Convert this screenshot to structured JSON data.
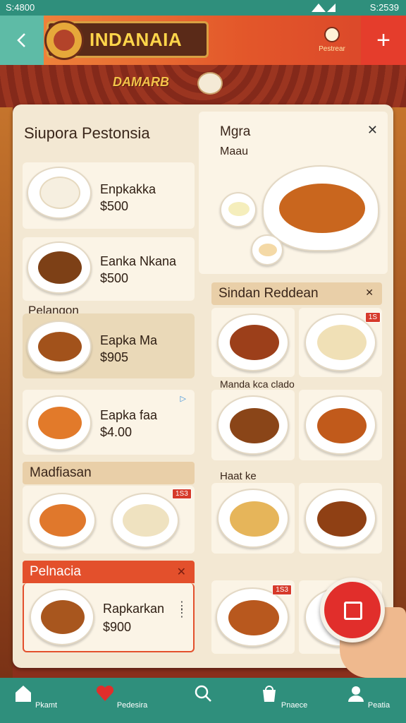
{
  "status_bar": {
    "time": "S:4800",
    "right": "S:2539"
  },
  "top_bar": {
    "logo_text": "INDANAIA",
    "account_label": "Pestrear"
  },
  "banner": {
    "ribbon": "DAMARB"
  },
  "left_column": {
    "title": "Siupora Pestonsia",
    "items": [
      {
        "name": "Enpkakka",
        "price": "$500"
      },
      {
        "name": "Eanka Nkana",
        "price": "$500"
      },
      {
        "name": "Eapka Ma",
        "price": "$905"
      },
      {
        "name": "Eapka faa",
        "price": "$4.00"
      }
    ],
    "section_label": "Pelangon",
    "section2": {
      "title": "Madfiasan",
      "badge": "1S3"
    },
    "section3": {
      "title": "Pelnacia",
      "item": {
        "name": "Rapkarkan",
        "price": "$900"
      }
    }
  },
  "right_column": {
    "title": "Mgra",
    "subtitle": "Maau",
    "section": {
      "title": "Sindan Reddean"
    },
    "label_mid": "Manda kca clado",
    "label_low": "Haat ke",
    "badge_top": "1S",
    "badge_bottom": "1S3"
  },
  "bottom_nav": [
    {
      "label": "Pkamt",
      "icon": "home-icon"
    },
    {
      "label": "Pedesira",
      "icon": "heart-icon"
    },
    {
      "label": "",
      "icon": "search-icon"
    },
    {
      "label": "Pnaece",
      "icon": "bag-icon"
    },
    {
      "label": "Peatia",
      "icon": "profile-icon"
    }
  ],
  "colors": {
    "teal": "#2f8f7c",
    "red": "#e12e2b",
    "orange": "#f08a3e"
  }
}
